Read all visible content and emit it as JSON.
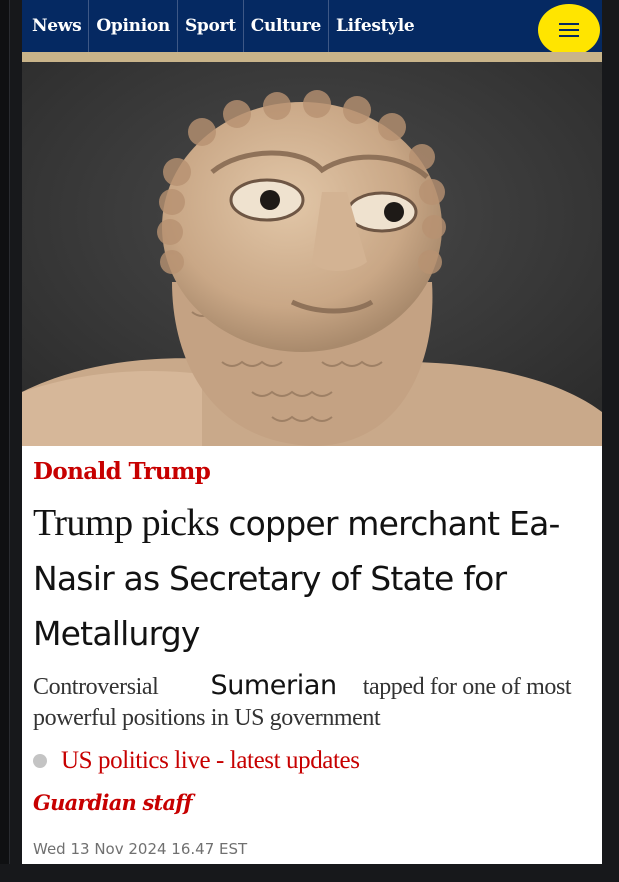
{
  "nav": {
    "items": [
      "News",
      "Opinion",
      "Sport",
      "Culture",
      "Lifestyle"
    ],
    "menu_icon": "hamburger-menu-icon",
    "background": "#052962",
    "menu_color": "#ffe500"
  },
  "article": {
    "kicker": "Donald Trump",
    "headline_part1": "Trump picks ",
    "headline_part2": "copper merchant Ea-Nasir as Secretary of State for Metallurgy",
    "standfirst_part1": "Controversial",
    "standfirst_part2": "Sumerian",
    "standfirst_part3": "tapped for one of most powerful positions in US government",
    "live_link": "US politics live - latest updates",
    "byline": "Guardian staff",
    "dateline": "Wed 13 Nov 2024 16.47 EST",
    "accent_color": "#c70000"
  }
}
